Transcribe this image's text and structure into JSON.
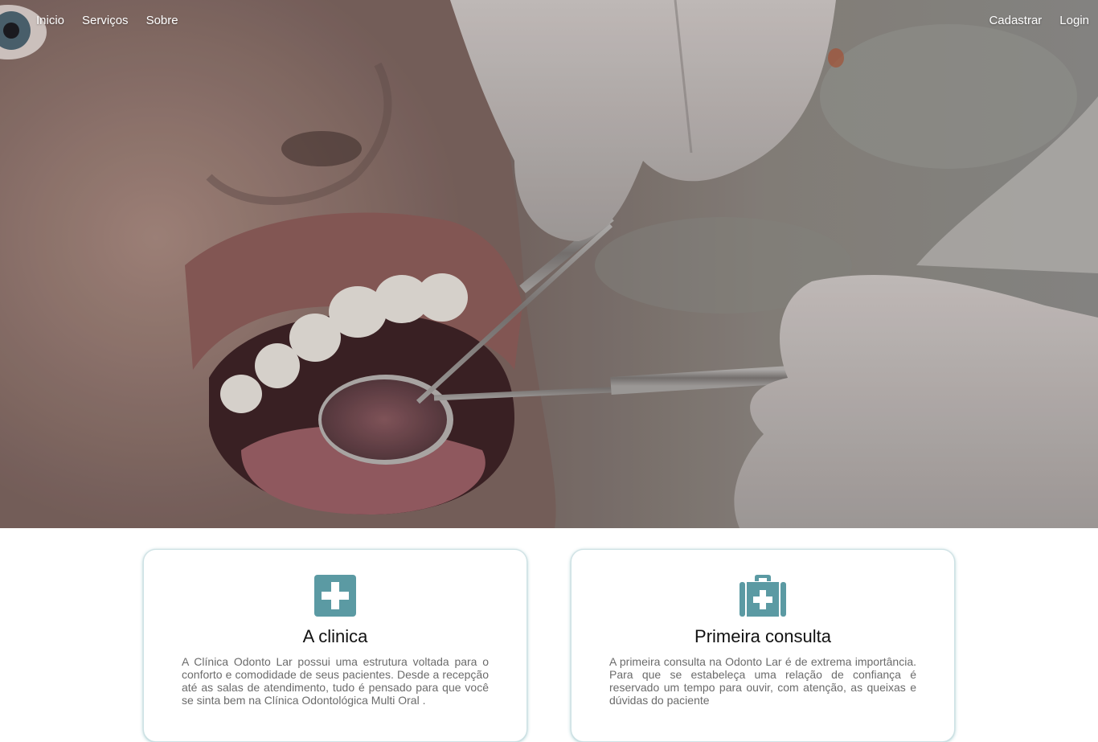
{
  "nav": {
    "left": [
      "Inicio",
      "Serviços",
      "Sobre"
    ],
    "right": [
      "Cadastrar",
      "Login"
    ]
  },
  "hero": {
    "image": "dental-exam-photo"
  },
  "cards": [
    {
      "icon": "plus-square-icon",
      "title": "A clinica",
      "text": "A Clínica Odonto Lar possui uma estrutura voltada para o conforto e comodidade de seus pacientes. Desde a recepção até as salas de atendimento, tudo é pensado para que você se sinta bem na Clínica Odontológica Multi Oral ."
    },
    {
      "icon": "medkit-icon",
      "title": "Primeira consulta",
      "text": "A primeira consulta na Odonto Lar é de extrema importância. Para que se estabeleça uma relação de confiança é reservado um tempo para ouvir, com atenção, as queixas e dúvidas do paciente"
    }
  ],
  "colors": {
    "accent": "#5b9aa3",
    "nav_text": "#ffffff",
    "body_text": "#6b6b6b"
  }
}
